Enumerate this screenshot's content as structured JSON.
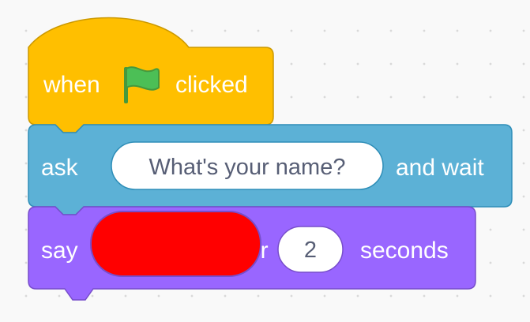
{
  "colors": {
    "events": "#ffbf00",
    "events_border": "#cc9900",
    "sensing": "#5cb1d6",
    "sensing_border": "#2e8eb8",
    "looks": "#9966ff",
    "looks_border": "#774dcb",
    "redaction": "#ff0000",
    "flag": "#4cbf56"
  },
  "blocks": {
    "hat": {
      "word_before": "when",
      "icon": "green-flag-icon",
      "word_after": "clicked"
    },
    "ask": {
      "word_before": "ask",
      "input_value": "What's your name?",
      "word_after": "and wait"
    },
    "say": {
      "word_before": "say",
      "partial_word": "or",
      "seconds_value": "2",
      "word_after": "seconds"
    }
  }
}
